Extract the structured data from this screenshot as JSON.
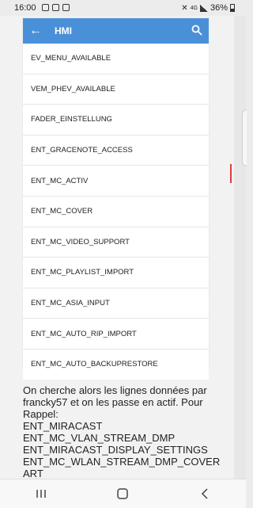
{
  "status_bar": {
    "time": "16:00",
    "battery": "36%",
    "left_icons": [
      "image-icon",
      "message-icon",
      "notification-icon"
    ],
    "right_icons": [
      "mute-icon",
      "4g-icon",
      "signal-icon",
      "battery-icon"
    ]
  },
  "app": {
    "title": "HMI",
    "accent": "#4a90d9",
    "items": [
      {
        "label": "EV_MENU_AVAILABLE"
      },
      {
        "label": "VEM_PHEV_AVAILABLE"
      },
      {
        "label": "FADER_EINSTELLUNG"
      },
      {
        "label": "ENT_GRACENOTE_ACCESS"
      },
      {
        "label": "ENT_MC_ACTIV"
      },
      {
        "label": "ENT_MC_COVER"
      },
      {
        "label": "ENT_MC_VIDEO_SUPPORT"
      },
      {
        "label": "ENT_MC_PLAYLIST_IMPORT"
      },
      {
        "label": "ENT_MC_ASIA_INPUT"
      },
      {
        "label": "ENT_MC_AUTO_RIP_IMPORT"
      },
      {
        "label": "ENT_MC_AUTO_BACKUPRESTORE"
      }
    ]
  },
  "article": {
    "paragraph": "On cherche alors les lignes données par francky57 et on les passe en actif. Pour Rappel:",
    "codes": [
      "ENT_MIRACAST",
      "ENT_MC_VLAN_STREAM_DMP",
      "ENT_MIRACAST_DISPLAY_SETTINGS",
      "ENT_MC_WLAN_STREAM_DMP_COVER",
      "ART"
    ]
  },
  "navbar": {
    "icons": [
      "recents-icon",
      "home-icon",
      "back-icon"
    ]
  }
}
